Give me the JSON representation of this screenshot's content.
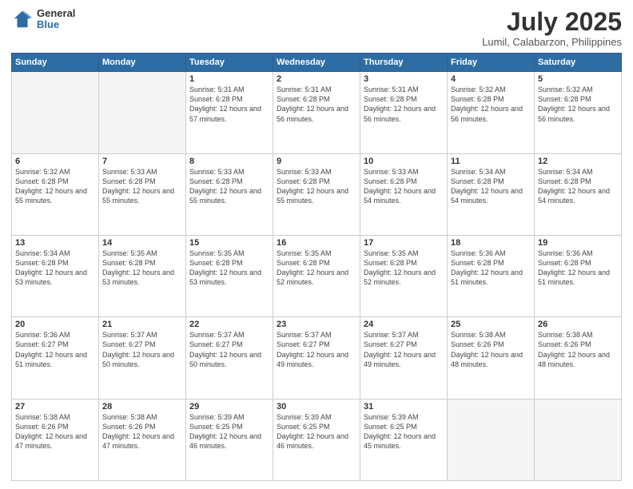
{
  "logo": {
    "general": "General",
    "blue": "Blue"
  },
  "title": "July 2025",
  "subtitle": "Lumil, Calabarzon, Philippines",
  "weekdays": [
    "Sunday",
    "Monday",
    "Tuesday",
    "Wednesday",
    "Thursday",
    "Friday",
    "Saturday"
  ],
  "weeks": [
    [
      {
        "day": "",
        "sunrise": "",
        "sunset": "",
        "daylight": ""
      },
      {
        "day": "",
        "sunrise": "",
        "sunset": "",
        "daylight": ""
      },
      {
        "day": "1",
        "sunrise": "Sunrise: 5:31 AM",
        "sunset": "Sunset: 6:28 PM",
        "daylight": "Daylight: 12 hours and 57 minutes."
      },
      {
        "day": "2",
        "sunrise": "Sunrise: 5:31 AM",
        "sunset": "Sunset: 6:28 PM",
        "daylight": "Daylight: 12 hours and 56 minutes."
      },
      {
        "day": "3",
        "sunrise": "Sunrise: 5:31 AM",
        "sunset": "Sunset: 6:28 PM",
        "daylight": "Daylight: 12 hours and 56 minutes."
      },
      {
        "day": "4",
        "sunrise": "Sunrise: 5:32 AM",
        "sunset": "Sunset: 6:28 PM",
        "daylight": "Daylight: 12 hours and 56 minutes."
      },
      {
        "day": "5",
        "sunrise": "Sunrise: 5:32 AM",
        "sunset": "Sunset: 6:28 PM",
        "daylight": "Daylight: 12 hours and 56 minutes."
      }
    ],
    [
      {
        "day": "6",
        "sunrise": "Sunrise: 5:32 AM",
        "sunset": "Sunset: 6:28 PM",
        "daylight": "Daylight: 12 hours and 55 minutes."
      },
      {
        "day": "7",
        "sunrise": "Sunrise: 5:33 AM",
        "sunset": "Sunset: 6:28 PM",
        "daylight": "Daylight: 12 hours and 55 minutes."
      },
      {
        "day": "8",
        "sunrise": "Sunrise: 5:33 AM",
        "sunset": "Sunset: 6:28 PM",
        "daylight": "Daylight: 12 hours and 55 minutes."
      },
      {
        "day": "9",
        "sunrise": "Sunrise: 5:33 AM",
        "sunset": "Sunset: 6:28 PM",
        "daylight": "Daylight: 12 hours and 55 minutes."
      },
      {
        "day": "10",
        "sunrise": "Sunrise: 5:33 AM",
        "sunset": "Sunset: 6:28 PM",
        "daylight": "Daylight: 12 hours and 54 minutes."
      },
      {
        "day": "11",
        "sunrise": "Sunrise: 5:34 AM",
        "sunset": "Sunset: 6:28 PM",
        "daylight": "Daylight: 12 hours and 54 minutes."
      },
      {
        "day": "12",
        "sunrise": "Sunrise: 5:34 AM",
        "sunset": "Sunset: 6:28 PM",
        "daylight": "Daylight: 12 hours and 54 minutes."
      }
    ],
    [
      {
        "day": "13",
        "sunrise": "Sunrise: 5:34 AM",
        "sunset": "Sunset: 6:28 PM",
        "daylight": "Daylight: 12 hours and 53 minutes."
      },
      {
        "day": "14",
        "sunrise": "Sunrise: 5:35 AM",
        "sunset": "Sunset: 6:28 PM",
        "daylight": "Daylight: 12 hours and 53 minutes."
      },
      {
        "day": "15",
        "sunrise": "Sunrise: 5:35 AM",
        "sunset": "Sunset: 6:28 PM",
        "daylight": "Daylight: 12 hours and 53 minutes."
      },
      {
        "day": "16",
        "sunrise": "Sunrise: 5:35 AM",
        "sunset": "Sunset: 6:28 PM",
        "daylight": "Daylight: 12 hours and 52 minutes."
      },
      {
        "day": "17",
        "sunrise": "Sunrise: 5:35 AM",
        "sunset": "Sunset: 6:28 PM",
        "daylight": "Daylight: 12 hours and 52 minutes."
      },
      {
        "day": "18",
        "sunrise": "Sunrise: 5:36 AM",
        "sunset": "Sunset: 6:28 PM",
        "daylight": "Daylight: 12 hours and 51 minutes."
      },
      {
        "day": "19",
        "sunrise": "Sunrise: 5:36 AM",
        "sunset": "Sunset: 6:28 PM",
        "daylight": "Daylight: 12 hours and 51 minutes."
      }
    ],
    [
      {
        "day": "20",
        "sunrise": "Sunrise: 5:36 AM",
        "sunset": "Sunset: 6:27 PM",
        "daylight": "Daylight: 12 hours and 51 minutes."
      },
      {
        "day": "21",
        "sunrise": "Sunrise: 5:37 AM",
        "sunset": "Sunset: 6:27 PM",
        "daylight": "Daylight: 12 hours and 50 minutes."
      },
      {
        "day": "22",
        "sunrise": "Sunrise: 5:37 AM",
        "sunset": "Sunset: 6:27 PM",
        "daylight": "Daylight: 12 hours and 50 minutes."
      },
      {
        "day": "23",
        "sunrise": "Sunrise: 5:37 AM",
        "sunset": "Sunset: 6:27 PM",
        "daylight": "Daylight: 12 hours and 49 minutes."
      },
      {
        "day": "24",
        "sunrise": "Sunrise: 5:37 AM",
        "sunset": "Sunset: 6:27 PM",
        "daylight": "Daylight: 12 hours and 49 minutes."
      },
      {
        "day": "25",
        "sunrise": "Sunrise: 5:38 AM",
        "sunset": "Sunset: 6:26 PM",
        "daylight": "Daylight: 12 hours and 48 minutes."
      },
      {
        "day": "26",
        "sunrise": "Sunrise: 5:38 AM",
        "sunset": "Sunset: 6:26 PM",
        "daylight": "Daylight: 12 hours and 48 minutes."
      }
    ],
    [
      {
        "day": "27",
        "sunrise": "Sunrise: 5:38 AM",
        "sunset": "Sunset: 6:26 PM",
        "daylight": "Daylight: 12 hours and 47 minutes."
      },
      {
        "day": "28",
        "sunrise": "Sunrise: 5:38 AM",
        "sunset": "Sunset: 6:26 PM",
        "daylight": "Daylight: 12 hours and 47 minutes."
      },
      {
        "day": "29",
        "sunrise": "Sunrise: 5:39 AM",
        "sunset": "Sunset: 6:25 PM",
        "daylight": "Daylight: 12 hours and 46 minutes."
      },
      {
        "day": "30",
        "sunrise": "Sunrise: 5:39 AM",
        "sunset": "Sunset: 6:25 PM",
        "daylight": "Daylight: 12 hours and 46 minutes."
      },
      {
        "day": "31",
        "sunrise": "Sunrise: 5:39 AM",
        "sunset": "Sunset: 6:25 PM",
        "daylight": "Daylight: 12 hours and 45 minutes."
      },
      {
        "day": "",
        "sunrise": "",
        "sunset": "",
        "daylight": ""
      },
      {
        "day": "",
        "sunrise": "",
        "sunset": "",
        "daylight": ""
      }
    ]
  ]
}
